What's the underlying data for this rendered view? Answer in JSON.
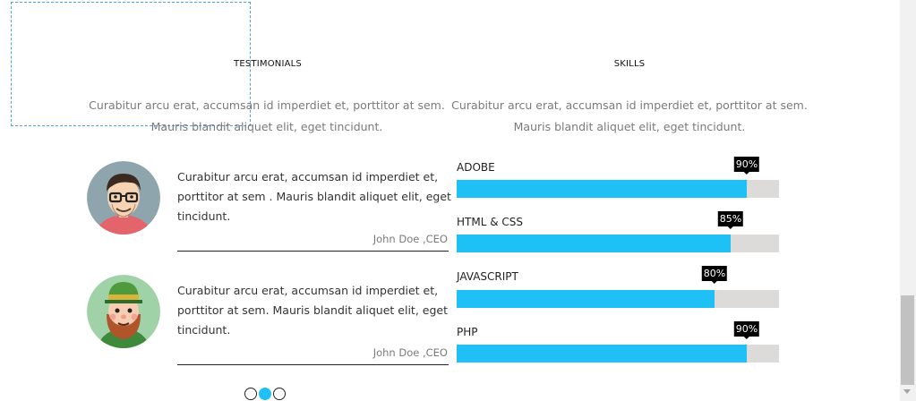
{
  "testimonials": {
    "title": "TESTIMONIALS",
    "description": "Curabitur arcu erat, accumsan id imperdiet et, porttitor at sem. Mauris blandit aliquet elit, eget tincidunt.",
    "items": [
      {
        "quote": "Curabitur arcu erat, accumsan id imperdiet et, porttitor at sem . Mauris blandit aliquet elit, eget tincidunt.",
        "author": "John Doe ,CEO",
        "avatar": "man-with-glasses-avatar"
      },
      {
        "quote": "Curabitur arcu erat, accumsan id imperdiet et, porttitor at sem. Mauris blandit aliquet elit, eget tincidunt.",
        "author": "John Doe ,CEO",
        "avatar": "leprechaun-avatar"
      }
    ],
    "pagination": {
      "count": 3,
      "active_index": 1
    }
  },
  "skills": {
    "title": "SKILLS",
    "description": "Curabitur arcu erat, accumsan id imperdiet et, porttitor at sem. Mauris blandit aliquet elit, eget tincidunt.",
    "items": [
      {
        "name": "ADOBE",
        "percent_label": "90%",
        "percent": 90
      },
      {
        "name": "HTML & CSS",
        "percent_label": "85%",
        "percent": 85
      },
      {
        "name": "JAVASCRIPT",
        "percent_label": "80%",
        "percent": 80
      },
      {
        "name": "PHP",
        "percent_label": "90%",
        "percent": 90
      }
    ]
  },
  "colors": {
    "accent": "#1ec0f6",
    "track": "#dddada",
    "badge": "#000000"
  }
}
